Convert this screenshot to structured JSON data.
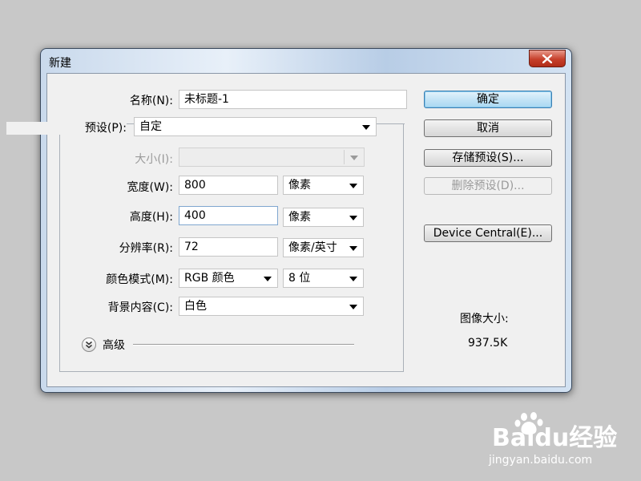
{
  "dialog": {
    "title": "新建"
  },
  "form": {
    "name": {
      "label": "名称(N):",
      "value": "未标题-1"
    },
    "preset": {
      "label": "预设(P):",
      "value": "自定"
    },
    "size": {
      "label": "大小(I):",
      "value": ""
    },
    "width": {
      "label": "宽度(W):",
      "value": "800",
      "unit": "像素"
    },
    "height": {
      "label": "高度(H):",
      "value": "400",
      "unit": "像素"
    },
    "resolution": {
      "label": "分辨率(R):",
      "value": "72",
      "unit": "像素/英寸"
    },
    "color_mode": {
      "label": "颜色模式(M):",
      "value": "RGB 颜色",
      "bit_depth": "8 位"
    },
    "background": {
      "label": "背景内容(C):",
      "value": "白色"
    },
    "advanced": {
      "label": "高级"
    }
  },
  "buttons": {
    "ok": "确定",
    "cancel": "取消",
    "save_preset": "存储预设(S)...",
    "delete_preset": "删除预设(D)...",
    "device_central": "Device Central(E)..."
  },
  "info": {
    "image_size_label": "图像大小:",
    "image_size_value": "937.5K"
  },
  "watermark": {
    "brand": "Baidu经验",
    "url": "jingyan.baidu.com"
  },
  "colors": {
    "background": "#c8c8c8",
    "default_button": "#a9d8f2",
    "close_button": "#c6402b"
  }
}
